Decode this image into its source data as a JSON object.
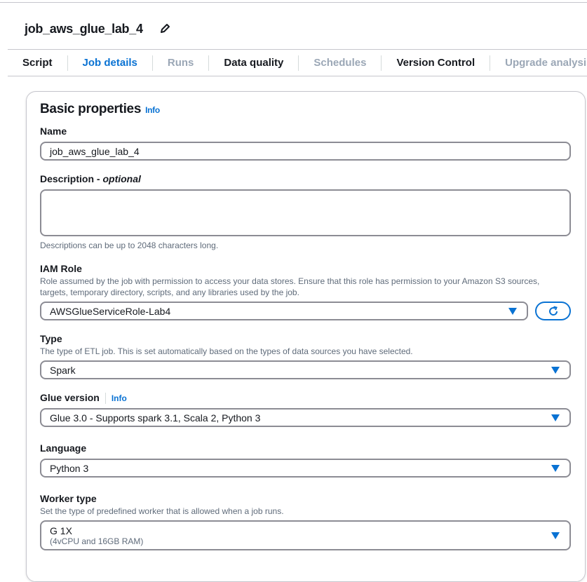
{
  "header": {
    "title": "job_aws_glue_lab_4"
  },
  "tabs": [
    {
      "label": "Script"
    },
    {
      "label": "Job details"
    },
    {
      "label": "Runs"
    },
    {
      "label": "Data quality"
    },
    {
      "label": "Schedules"
    },
    {
      "label": "Version Control"
    },
    {
      "label": "Upgrade analysis"
    }
  ],
  "active_tab": "Job details",
  "basic": {
    "title": "Basic properties",
    "info": "Info",
    "name": {
      "label": "Name",
      "value": "job_aws_glue_lab_4"
    },
    "description": {
      "label": "Description",
      "optional": "optional",
      "value": "",
      "help": "Descriptions can be up to 2048 characters long."
    },
    "iam": {
      "label": "IAM Role",
      "desc": "Role assumed by the job with permission to access your data stores. Ensure that this role has permission to your Amazon S3 sources, targets, temporary directory, scripts, and any libraries used by the job.",
      "value": "AWSGlueServiceRole-Lab4"
    },
    "type": {
      "label": "Type",
      "desc": "The type of ETL job. This is set automatically based on the types of data sources you have selected.",
      "value": "Spark"
    },
    "glue": {
      "label": "Glue version",
      "info": "Info",
      "value": "Glue 3.0 - Supports spark 3.1, Scala 2, Python 3"
    },
    "language": {
      "label": "Language",
      "value": "Python 3"
    },
    "worker": {
      "label": "Worker type",
      "desc": "Set the type of predefined worker that is allowed when a job runs.",
      "value": "G 1X",
      "sub": "(4vCPU and 16GB RAM)"
    }
  },
  "colors": {
    "accent": "#0972d3",
    "border": "#8c8c94"
  }
}
